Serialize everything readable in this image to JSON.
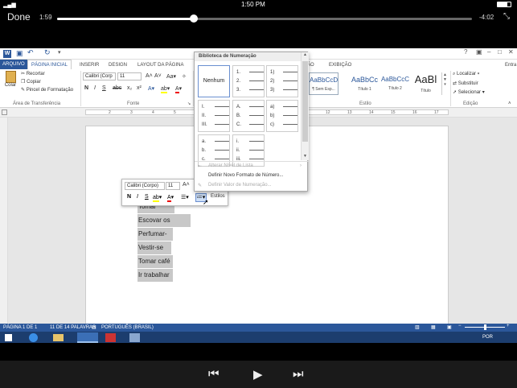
{
  "ios": {
    "time": "1:50 PM",
    "battery_icon": "battery-icon",
    "wifi_icon": "wifi-icon"
  },
  "player": {
    "done": "Done",
    "elapsed": "1:59",
    "remaining": "-4:02",
    "progress": 0.33
  },
  "word": {
    "tabs": [
      "ARQUIVO",
      "PÁGINA INICIAL",
      "INSERIR",
      "DESIGN",
      "LAYOUT DA PÁGINA",
      "ÃO",
      "EXIBIÇÃO",
      "Entra"
    ],
    "clipboard": {
      "paste": "Colar",
      "cut": "Recortar",
      "copy": "Copiar",
      "format_painter": "Pincel de Formatação",
      "group": "Área de Transferência"
    },
    "font": {
      "name": "Calibri (Corp",
      "size": "11",
      "group": "Fonte"
    },
    "styles": [
      {
        "sample": "AaBbCcDc",
        "name": "¶ Sem Esp..."
      },
      {
        "sample": "AaBbCc",
        "name": "Título 1"
      },
      {
        "sample": "AaBbCcC",
        "name": "Título 2"
      },
      {
        "sample": "AaBl",
        "name": "Título"
      }
    ],
    "styles_group": "Estilo",
    "editing": {
      "find": "Localizar",
      "replace": "Substituir",
      "select": "Selecionar",
      "group": "Edição"
    },
    "ruler_numbers": [
      "2",
      "3",
      "4",
      "5",
      "6",
      "7",
      "8",
      "9",
      "10",
      "11",
      "12",
      "13",
      "14",
      "15",
      "16",
      "17"
    ]
  },
  "numlib": {
    "title": "Biblioteca de Numeração",
    "none": "Nenhum",
    "formats": [
      [
        "1.",
        "2.",
        "3."
      ],
      [
        "1)",
        "2)",
        "3)"
      ],
      [
        "I.",
        "II.",
        "III."
      ],
      [
        "A.",
        "B.",
        "C."
      ],
      [
        "a)",
        "b)",
        "c)"
      ],
      [
        "a.",
        "b.",
        "c."
      ],
      [
        "i.",
        "ii.",
        "iii."
      ]
    ],
    "menu": [
      {
        "label": "Alterar Nível de Lista",
        "enabled": false
      },
      {
        "label": "Definir Novo Formato de Número...",
        "enabled": true
      },
      {
        "label": "Definir Valor de Numeração...",
        "enabled": false
      }
    ]
  },
  "mini": {
    "font": "Calibri (Corpo)",
    "size": "11",
    "styles": "Estilos"
  },
  "list_items": [
    "Tomar banho",
    "Escovar os dentes",
    "Perfumar-se",
    "Vestir-se",
    "Tomar café",
    "Ir trabalhar"
  ],
  "status": {
    "page": "PÁGINA 1 DE 1",
    "words": "11 DE 14 PALAVRAS",
    "lang": "PORTUGUÊS (BRASIL)",
    "tray_lang": "POR"
  },
  "controls": {
    "prev": "⏮",
    "play": "▶",
    "next": "⏭"
  }
}
